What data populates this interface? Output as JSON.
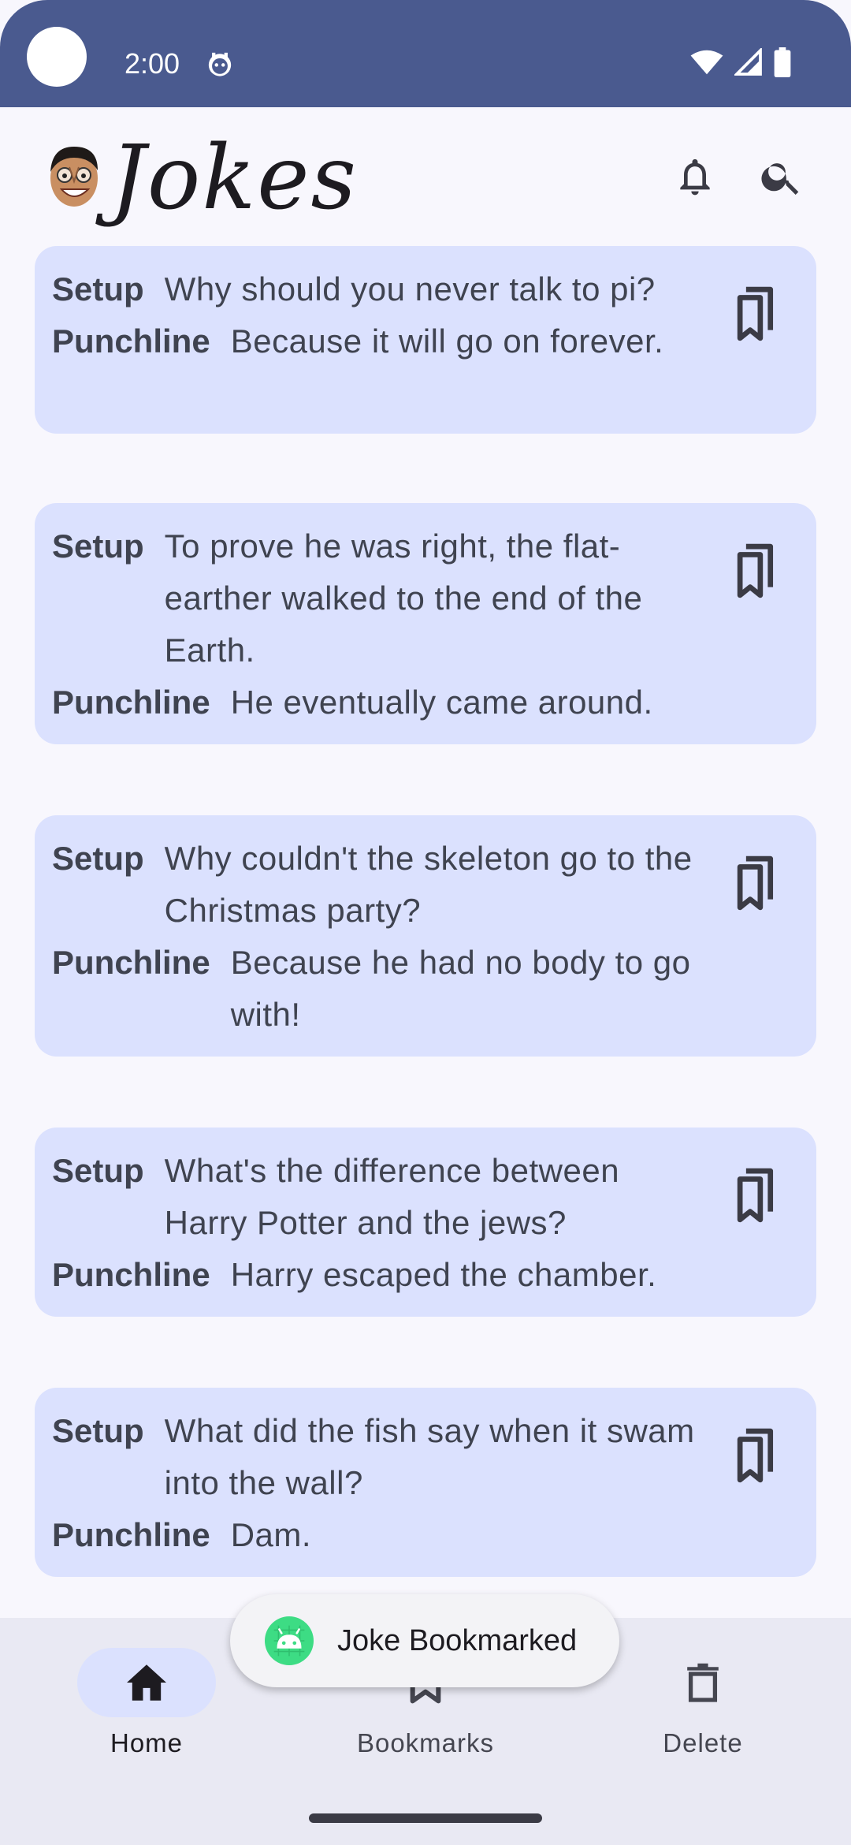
{
  "status_bar": {
    "time": "2:00"
  },
  "app_bar": {
    "title": "Jokes"
  },
  "labels": {
    "setup": "Setup",
    "punchline": "Punchline"
  },
  "jokes": [
    {
      "setup": "Why should you never talk to pi?",
      "punchline": "Because it will go on forever."
    },
    {
      "setup": "To prove he was right, the flat-earther walked to the end of the Earth.",
      "punchline": "He eventually came around."
    },
    {
      "setup": "Why couldn't the skeleton go to the Christmas party?",
      "punchline": "Because he had no body to go with!"
    },
    {
      "setup": "What's the difference between Harry Potter and the jews?",
      "punchline": "Harry escaped the chamber."
    },
    {
      "setup": "What did the fish say when it swam into the wall?",
      "punchline": "Dam."
    }
  ],
  "bottom_nav": {
    "items": [
      {
        "label": "Home",
        "icon": "home-icon",
        "active": true
      },
      {
        "label": "Bookmarks",
        "icon": "bookmark-icon",
        "active": false
      },
      {
        "label": "Delete",
        "icon": "trash-icon",
        "active": false
      }
    ]
  },
  "toast": {
    "text": "Joke Bookmarked",
    "icon": "android-icon"
  },
  "colors": {
    "status_bar": "#4a5a8f",
    "card": "#dbe1fe",
    "background": "#f8f7fd",
    "nav_background": "#e9e9f3",
    "text": "#3f4350"
  }
}
